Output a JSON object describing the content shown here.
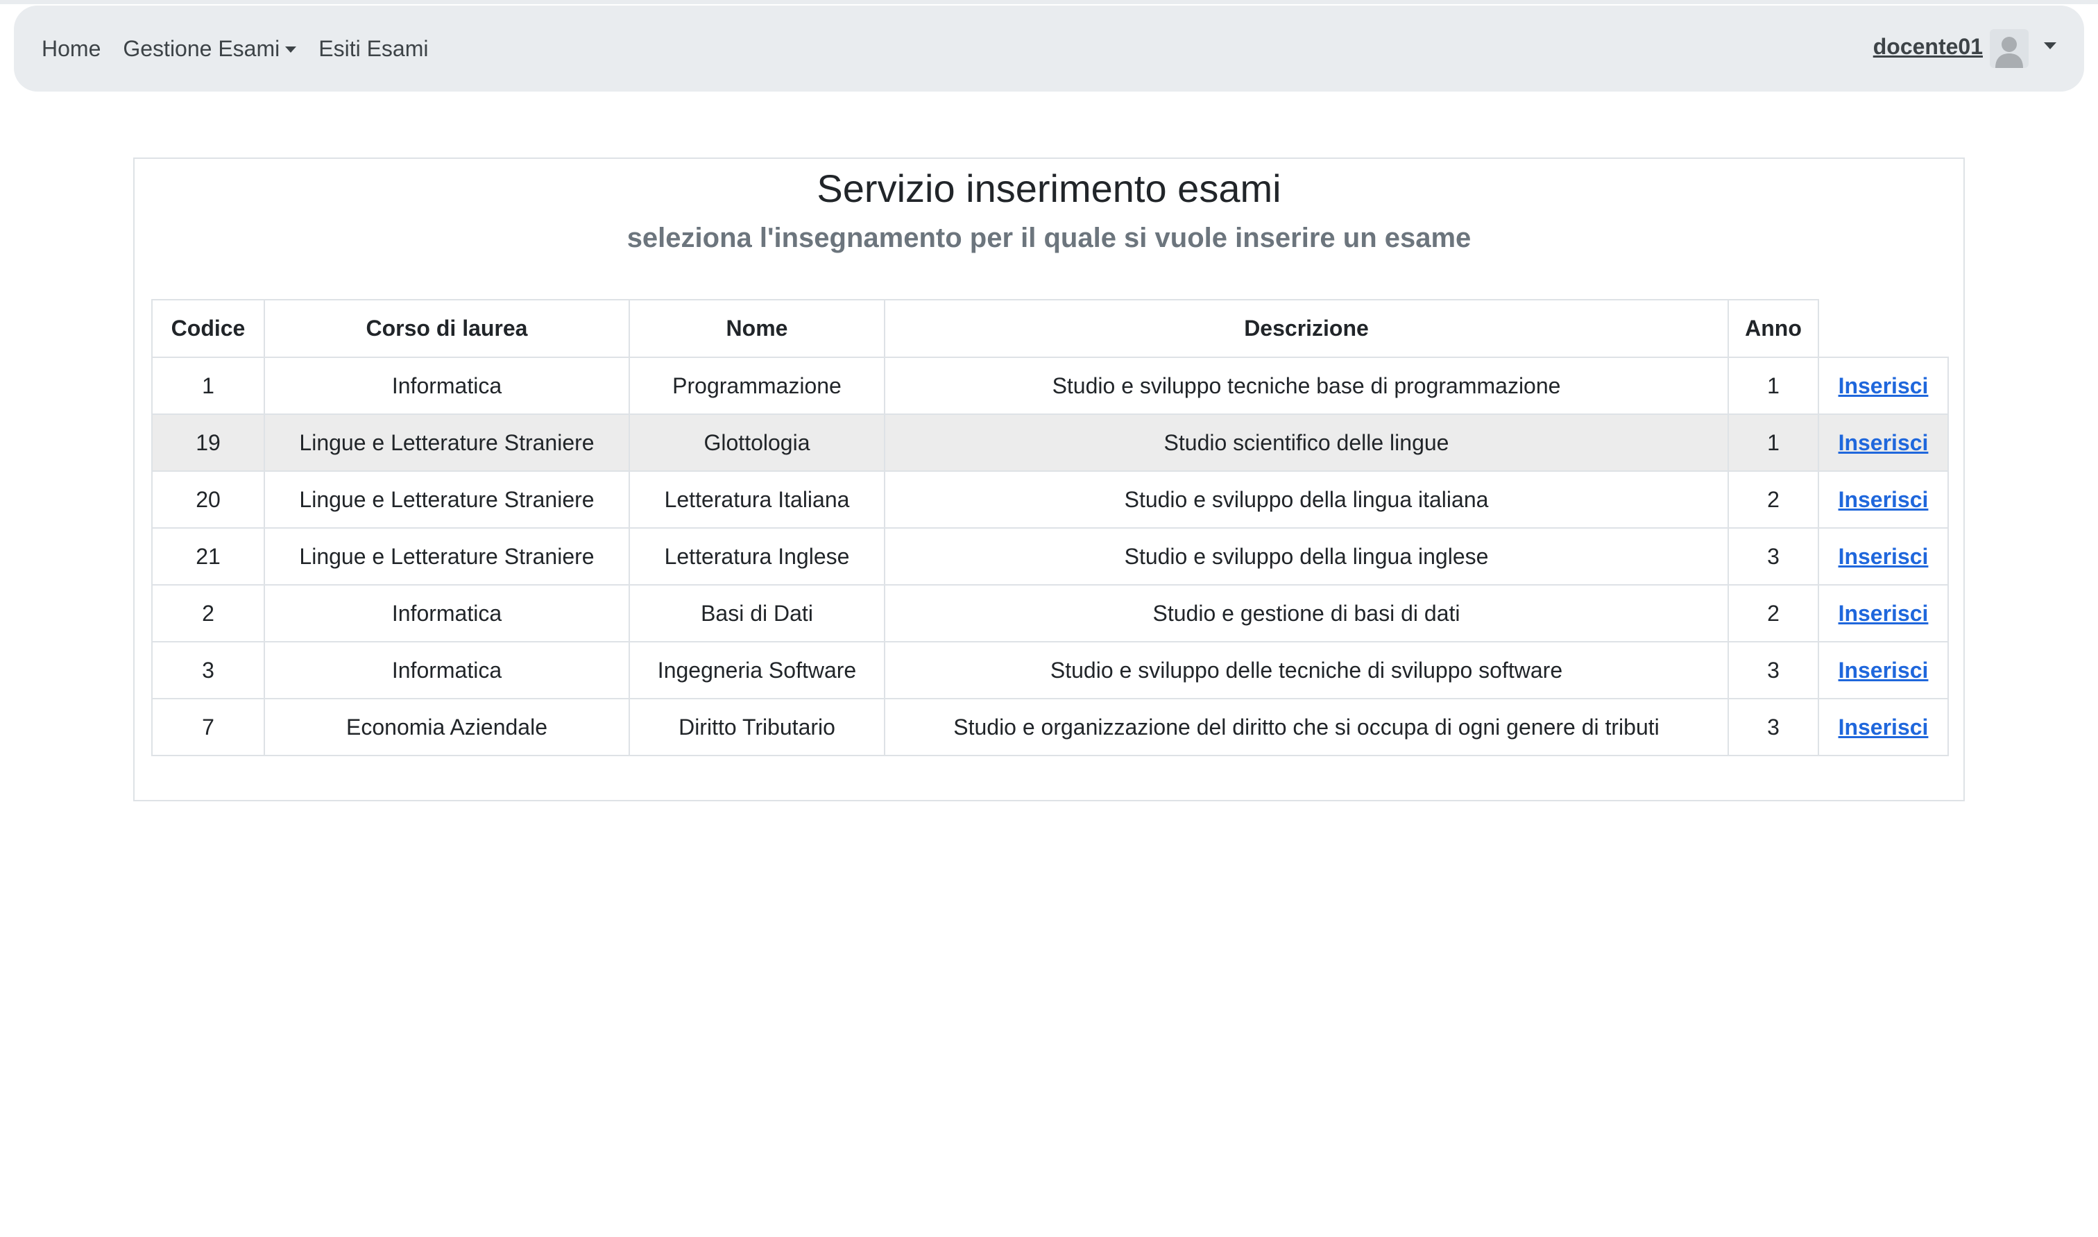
{
  "navbar": {
    "home_label": "Home",
    "gestione_label": "Gestione Esami",
    "esiti_label": "Esiti Esami",
    "user_name": "docente01"
  },
  "main": {
    "title": "Servizio inserimento esami",
    "subtitle": "seleziona l'insegnamento per il quale si vuole inserire un esame"
  },
  "table": {
    "headers": [
      "Codice",
      "Corso di laurea",
      "Nome",
      "Descrizione",
      "Anno"
    ],
    "rows": [
      {
        "codice": "1",
        "corso": "Informatica",
        "nome": "Programmazione",
        "descrizione": "Studio e sviluppo tecniche base di programmazione",
        "anno": "1",
        "action": "Inserisci"
      },
      {
        "codice": "19",
        "corso": "Lingue e Letterature Straniere",
        "nome": "Glottologia",
        "descrizione": "Studio scientifico delle lingue",
        "anno": "1",
        "action": "Inserisci"
      },
      {
        "codice": "20",
        "corso": "Lingue e Letterature Straniere",
        "nome": "Letteratura Italiana",
        "descrizione": "Studio e sviluppo della lingua italiana",
        "anno": "2",
        "action": "Inserisci"
      },
      {
        "codice": "21",
        "corso": "Lingue e Letterature Straniere",
        "nome": "Letteratura Inglese",
        "descrizione": "Studio e sviluppo della lingua inglese",
        "anno": "3",
        "action": "Inserisci"
      },
      {
        "codice": "2",
        "corso": "Informatica",
        "nome": "Basi di Dati",
        "descrizione": "Studio e gestione di basi di dati",
        "anno": "2",
        "action": "Inserisci"
      },
      {
        "codice": "3",
        "corso": "Informatica",
        "nome": "Ingegneria Software",
        "descrizione": "Studio e sviluppo delle tecniche di sviluppo software",
        "anno": "3",
        "action": "Inserisci"
      },
      {
        "codice": "7",
        "corso": "Economia Aziendale",
        "nome": "Diritto Tributario",
        "descrizione": "Studio e organizzazione del diritto che si occupa di ogni genere di tributi",
        "anno": "3",
        "action": "Inserisci"
      }
    ]
  },
  "colors": {
    "navbar_bg": "#e9ecef",
    "link": "#1f67dc",
    "highlight_row": "#ececec",
    "subtitle": "#6c757d"
  },
  "icons": {
    "avatar": "user-avatar-icon",
    "dropdown": "caret-down-icon"
  }
}
